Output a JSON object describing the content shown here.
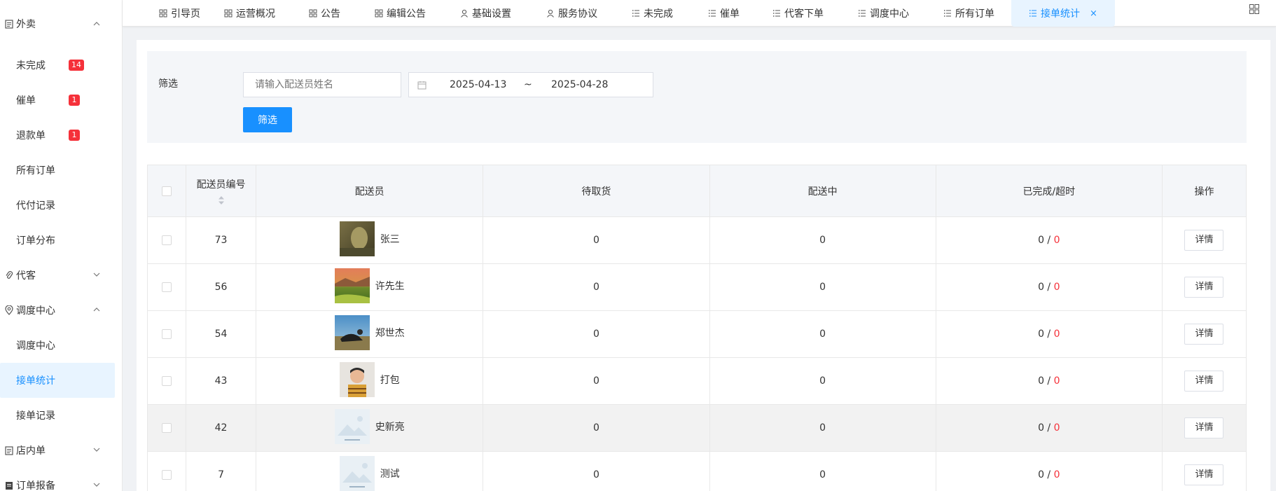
{
  "sidebar": {
    "groups": [
      {
        "label": "外卖",
        "icon": "document-icon",
        "expanded": true,
        "items": [
          {
            "label": "未完成",
            "badge": "14"
          },
          {
            "label": "催单",
            "badge": "1"
          },
          {
            "label": "退款单",
            "badge": "1"
          },
          {
            "label": "所有订单"
          },
          {
            "label": "代付记录"
          },
          {
            "label": "订单分布"
          }
        ]
      },
      {
        "label": "代客",
        "icon": "paperclip-icon",
        "expanded": false
      },
      {
        "label": "调度中心",
        "icon": "location-icon",
        "expanded": true,
        "items": [
          {
            "label": "调度中心"
          },
          {
            "label": "接单统计",
            "active": true
          },
          {
            "label": "接单记录"
          }
        ]
      },
      {
        "label": "店内单",
        "icon": "document-icon",
        "expanded": false
      },
      {
        "label": "订单报备",
        "icon": "report-icon",
        "expanded": false
      }
    ]
  },
  "tabs": [
    {
      "label": "引导页",
      "icon": "grid-icon"
    },
    {
      "label": "运营概况",
      "icon": "grid-icon"
    },
    {
      "label": "公告",
      "icon": "grid-icon"
    },
    {
      "label": "编辑公告",
      "icon": "grid-icon"
    },
    {
      "label": "基础设置",
      "icon": "user-icon"
    },
    {
      "label": "服务协议",
      "icon": "user-icon"
    },
    {
      "label": "未完成",
      "icon": "list-icon"
    },
    {
      "label": "催单",
      "icon": "list-icon"
    },
    {
      "label": "代客下单",
      "icon": "list-icon"
    },
    {
      "label": "调度中心",
      "icon": "list-icon"
    },
    {
      "label": "所有订单",
      "icon": "list-icon"
    },
    {
      "label": "接单统计",
      "icon": "list-icon",
      "active": true,
      "close": "×"
    }
  ],
  "filter": {
    "label": "筛选",
    "name_placeholder": "请输入配送员姓名",
    "date_start": "2025-04-13",
    "date_sep": "~",
    "date_end": "2025-04-28",
    "button": "筛选"
  },
  "table": {
    "headers": {
      "id": "配送员编号",
      "rider": "配送员",
      "pending_pickup": "待取货",
      "delivering": "配送中",
      "completed_overtime": "已完成/超时",
      "action": "操作"
    },
    "rows": [
      {
        "id": "73",
        "name": "张三",
        "pending": "0",
        "delivering": "0",
        "completed": "0",
        "overtime": "0",
        "action": "详情"
      },
      {
        "id": "56",
        "name": "许先生",
        "pending": "0",
        "delivering": "0",
        "completed": "0",
        "overtime": "0",
        "action": "详情"
      },
      {
        "id": "54",
        "name": "郑世杰",
        "pending": "0",
        "delivering": "0",
        "completed": "0",
        "overtime": "0",
        "action": "详情"
      },
      {
        "id": "43",
        "name": "打包",
        "pending": "0",
        "delivering": "0",
        "completed": "0",
        "overtime": "0",
        "action": "详情"
      },
      {
        "id": "42",
        "name": "史新亮",
        "pending": "0",
        "delivering": "0",
        "completed": "0",
        "overtime": "0",
        "action": "详情"
      },
      {
        "id": "7",
        "name": "测试",
        "pending": "0",
        "delivering": "0",
        "completed": "0",
        "overtime": "0",
        "action": "详情"
      }
    ],
    "slash": " / "
  },
  "colors": {
    "accent": "#1890ff",
    "badge": "#f5313a",
    "active_bg": "#e8f4ff"
  }
}
